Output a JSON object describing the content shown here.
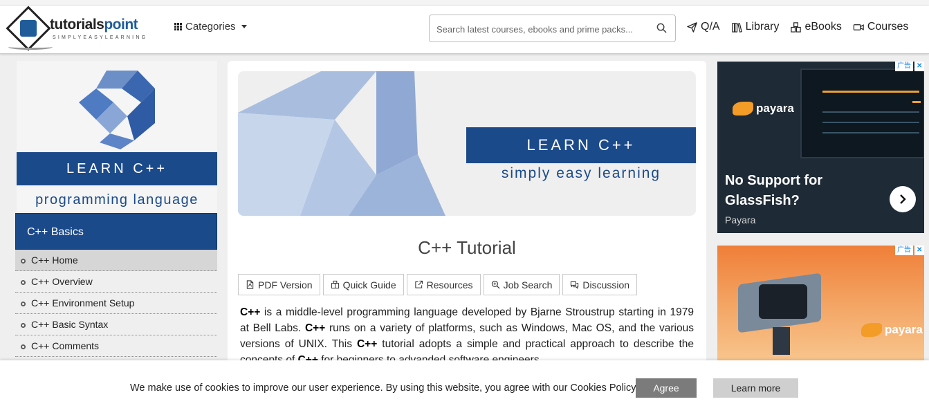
{
  "header": {
    "logo": {
      "brand_main": "tutorials",
      "brand_accent": "point",
      "tagline": "SIMPLYEASYLEARNING"
    },
    "categories_label": "Categories",
    "search": {
      "placeholder": "Search latest courses, ebooks and prime packs...",
      "value": ""
    },
    "nav": [
      {
        "label": "Q/A",
        "icon": "paper-plane-icon"
      },
      {
        "label": "Library",
        "icon": "books-icon"
      },
      {
        "label": "eBooks",
        "icon": "boxes-icon"
      },
      {
        "label": "Courses",
        "icon": "video-camera-icon"
      }
    ]
  },
  "sidebar": {
    "image": {
      "title": "LEARN C++",
      "subtitle": "programming language"
    },
    "heading": "C++ Basics",
    "items": [
      {
        "label": "C++ Home",
        "active": true
      },
      {
        "label": "C++ Overview",
        "active": false
      },
      {
        "label": "C++ Environment Setup",
        "active": false
      },
      {
        "label": "C++ Basic Syntax",
        "active": false
      },
      {
        "label": "C++ Comments",
        "active": false
      }
    ]
  },
  "main": {
    "banner": {
      "title": "LEARN C++",
      "subtitle": "simply easy learning"
    },
    "title": "C++ Tutorial",
    "buttons": [
      {
        "label": "PDF Version",
        "icon": "pdf-icon"
      },
      {
        "label": "Quick Guide",
        "icon": "quick-guide-icon"
      },
      {
        "label": "Resources",
        "icon": "external-link-icon"
      },
      {
        "label": "Job Search",
        "icon": "search-icon"
      },
      {
        "label": "Discussion",
        "icon": "comments-icon"
      }
    ],
    "intro": {
      "s1_bold": "C++",
      "s1_text": " is a middle-level programming language developed by Bjarne Stroustrup starting in 1979 at Bell Labs. ",
      "s2_bold": "C++",
      "s2_text": " runs on a variety of platforms, such as Windows, Mac OS, and the various versions of UNIX. This ",
      "s3_bold": "C++",
      "s3_text": " tutorial adopts a simple and practical approach to describe the concepts of ",
      "s4_bold": "C++",
      "s4_text": " for beginners to advanded software engineers."
    }
  },
  "ads": [
    {
      "headline": "No Support for GlassFish?",
      "brand": "Payara",
      "logo_text": "payara",
      "adchoice": "广告"
    },
    {
      "logo_text": "payara",
      "adchoice": "广告"
    }
  ],
  "cookie": {
    "message": "We make use of cookies to improve our user experience. By using this website, you agree with our Cookies Policy.",
    "agree_label": "Agree",
    "learn_more_label": "Learn more"
  },
  "colors": {
    "brand_blue": "#1b4a8a",
    "payara_orange": "#f39c28"
  }
}
